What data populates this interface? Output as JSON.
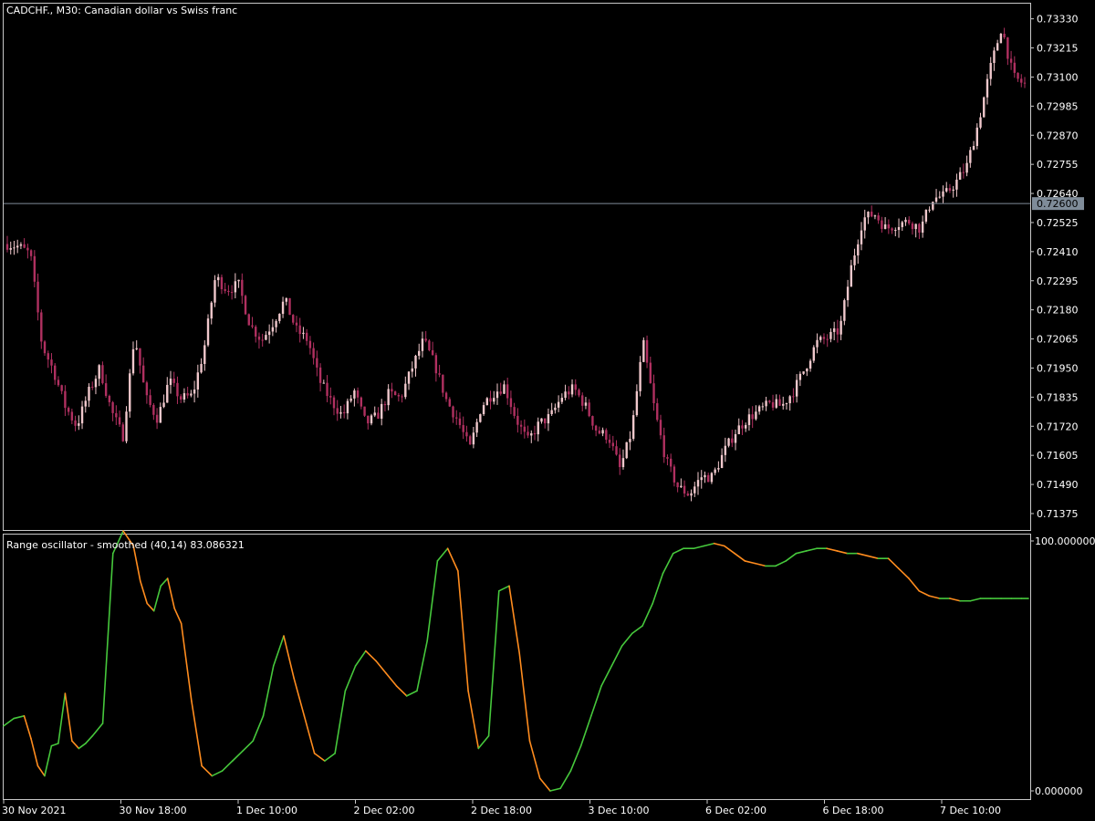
{
  "header": {
    "price_title": "CADCHF., M30:  Canadian dollar vs Swiss franc",
    "osc_title": "Range oscillator - smoothed (40,14) 83.086321"
  },
  "colors": {
    "background": "#000000",
    "border": "#c8c8c8",
    "candle_bull": "#f0c8cc",
    "candle_bear": "#b03060",
    "osc_up": "#46c83c",
    "osc_down": "#ff8c1e",
    "price_line": "#7f8c99"
  },
  "chart_data": [
    {
      "type": "candlestick",
      "title": "CADCHF., M30:  Canadian dollar vs Swiss franc",
      "ylim": [
        0.7131,
        0.7339
      ],
      "y_ticks": [
        "0.73330",
        "0.73215",
        "0.73100",
        "0.72985",
        "0.72870",
        "0.72755",
        "0.72640",
        "0.72525",
        "0.72410",
        "0.72295",
        "0.72180",
        "0.72065",
        "0.71950",
        "0.71835",
        "0.71720",
        "0.71605",
        "0.71490",
        "0.71375"
      ],
      "y_tick_values": [
        0.7333,
        0.73215,
        0.731,
        0.72985,
        0.7287,
        0.72755,
        0.7264,
        0.72525,
        0.7241,
        0.72295,
        0.7218,
        0.72065,
        0.7195,
        0.71835,
        0.7172,
        0.71605,
        0.7149,
        0.71375
      ],
      "current_price": {
        "label": "0.72600",
        "value": 0.726
      },
      "x_ticks": [
        "30 Nov 2021",
        "30 Nov 18:00",
        "1 Dec 10:00",
        "2 Dec 02:00",
        "2 Dec 18:00",
        "3 Dec 10:00",
        "6 Dec 02:00",
        "6 Dec 18:00",
        "7 Dec 10:00"
      ],
      "close_path": [
        0.7244,
        0.7243,
        0.724,
        0.7204,
        0.7194,
        0.718,
        0.7172,
        0.7185,
        0.7195,
        0.7178,
        0.7168,
        0.7208,
        0.7183,
        0.7175,
        0.719,
        0.7183,
        0.7184,
        0.7202,
        0.7231,
        0.7226,
        0.7228,
        0.7212,
        0.7206,
        0.7213,
        0.7222,
        0.721,
        0.7206,
        0.719,
        0.7182,
        0.7176,
        0.7186,
        0.7173,
        0.7176,
        0.7185,
        0.7183,
        0.7195,
        0.7206,
        0.7196,
        0.7182,
        0.7174,
        0.7163,
        0.718,
        0.7185,
        0.7188,
        0.7175,
        0.7166,
        0.7173,
        0.7176,
        0.7184,
        0.7187,
        0.718,
        0.717,
        0.7168,
        0.7155,
        0.717,
        0.7205,
        0.7178,
        0.7158,
        0.7148,
        0.7145,
        0.7152,
        0.7152,
        0.7162,
        0.717,
        0.7175,
        0.7178,
        0.7181,
        0.718,
        0.7186,
        0.7195,
        0.7205,
        0.7207,
        0.721,
        0.7235,
        0.7254,
        0.7256,
        0.725,
        0.7252,
        0.7253,
        0.725,
        0.7262,
        0.7263,
        0.7268,
        0.7275,
        0.7292,
        0.7313,
        0.733,
        0.731,
        0.7307
      ]
    },
    {
      "type": "line",
      "title": "Range oscillator - smoothed (40,14) 83.086321",
      "ylim": [
        0,
        100
      ],
      "y_ticks": [
        "100.000000",
        "0.000000"
      ],
      "y_tick_values": [
        100,
        0
      ],
      "x": [
        0,
        3,
        6,
        8,
        10,
        12,
        14,
        16,
        18,
        20,
        22,
        24,
        26,
        29,
        32,
        35,
        38,
        40,
        42,
        44,
        46,
        48,
        50,
        52,
        55,
        58,
        61,
        64,
        67,
        70,
        73,
        76,
        79,
        82,
        85,
        88,
        91,
        94,
        97,
        100,
        103,
        106,
        109,
        112,
        115,
        118,
        121,
        124,
        127,
        130,
        133,
        136,
        139,
        142,
        145,
        148,
        151,
        154,
        157,
        160,
        163,
        166,
        169,
        172,
        175,
        178,
        181,
        184,
        187,
        190,
        193,
        196,
        199,
        202,
        205,
        208,
        211,
        214,
        217,
        220,
        223,
        226,
        229,
        232,
        235,
        238,
        241,
        244,
        247,
        250,
        253,
        256,
        259,
        262,
        265,
        268,
        271,
        274,
        277,
        280,
        283,
        286,
        289,
        292,
        295,
        298,
        300
      ],
      "values": [
        26,
        29,
        30,
        21,
        10,
        6,
        18,
        19,
        39,
        20,
        17,
        19,
        22,
        27,
        95,
        104,
        98,
        84,
        75,
        72,
        82,
        85,
        73,
        67,
        36,
        10,
        6,
        8,
        12,
        16,
        20,
        30,
        50,
        62,
        45,
        30,
        15,
        12,
        15,
        40,
        50,
        56,
        52,
        47,
        42,
        38,
        40,
        60,
        92,
        97,
        88,
        40,
        17,
        22,
        80,
        82,
        55,
        20,
        5,
        0,
        1,
        8,
        18,
        30,
        42,
        50,
        58,
        63,
        66,
        75,
        87,
        95,
        97,
        97,
        98,
        99,
        98,
        95,
        92,
        91,
        90,
        90,
        92,
        95,
        96,
        97,
        97,
        96,
        95,
        95,
        94,
        93,
        93,
        89,
        85,
        80,
        78,
        77,
        77,
        76,
        76,
        77,
        77,
        77,
        77,
        77,
        77
      ]
    }
  ]
}
